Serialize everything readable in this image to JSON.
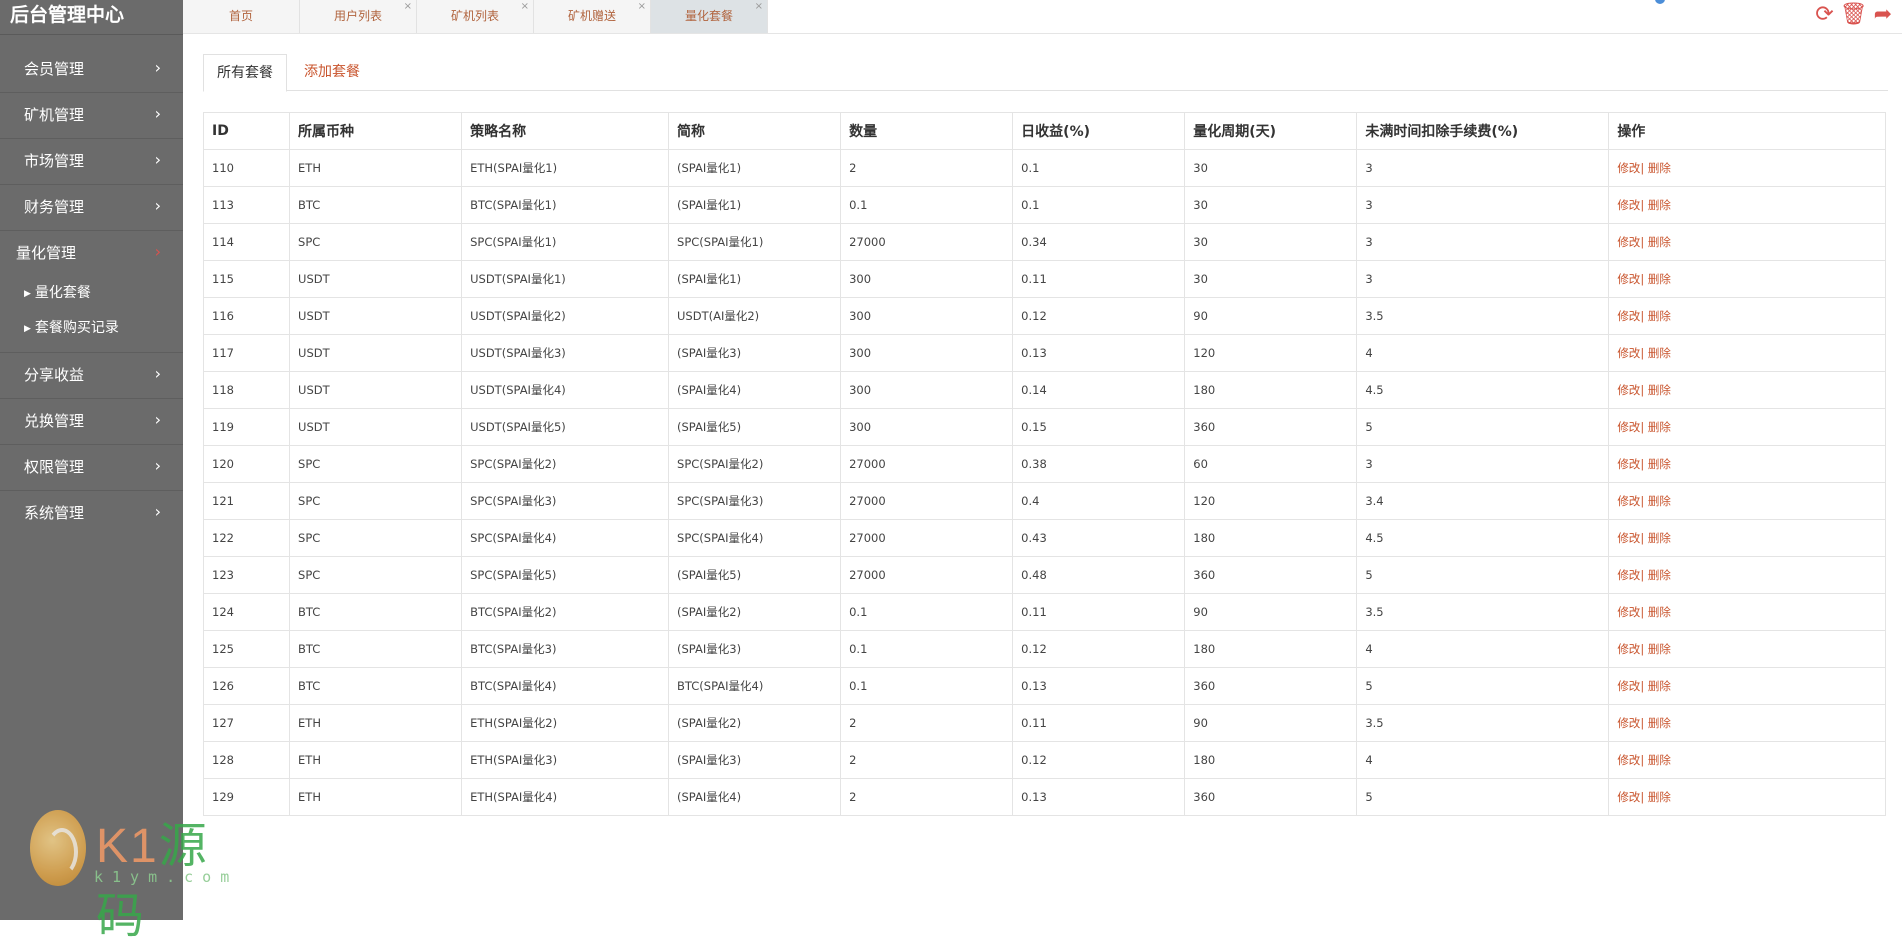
{
  "app_title": "后台管理中心",
  "sidebar": {
    "items": [
      {
        "label": "会员管理",
        "icon": "chevron-right-icon"
      },
      {
        "label": "矿机管理",
        "icon": "chevron-right-icon"
      },
      {
        "label": "市场管理",
        "icon": "chevron-right-icon"
      },
      {
        "label": "财务管理",
        "icon": "chevron-right-icon"
      },
      {
        "label": "量化管理",
        "icon": "chevron-down-icon"
      },
      {
        "label": "分享收益",
        "icon": "chevron-right-icon"
      },
      {
        "label": "兑换管理",
        "icon": "chevron-right-icon"
      },
      {
        "label": "权限管理",
        "icon": "chevron-right-icon"
      },
      {
        "label": "系统管理",
        "icon": "chevron-right-icon"
      }
    ],
    "sub_items": [
      "量化套餐",
      "套餐购买记录"
    ]
  },
  "page_tabs": [
    "首页",
    "用户列表",
    "矿机列表",
    "矿机赠送",
    "量化套餐"
  ],
  "active_page_tab": "量化套餐",
  "top_actions": [
    "refresh-icon",
    "trash-icon",
    "logout-icon"
  ],
  "content_tabs": {
    "all": "所有套餐",
    "add": "添加套餐"
  },
  "table": {
    "headers": [
      "ID",
      "所属币种",
      "策略名称",
      "简称",
      "数量",
      "日收益(%)",
      "量化周期(天)",
      "未满时间扣除手续费(%)",
      "操作"
    ],
    "edit_label": "修改",
    "delete_label": "删除",
    "rows": [
      [
        "110",
        "ETH",
        "ETH(SPAI量化1)",
        "(SPAI量化1)",
        "2",
        "0.1",
        "30",
        "3"
      ],
      [
        "113",
        "BTC",
        "BTC(SPAI量化1)",
        "(SPAI量化1)",
        "0.1",
        "0.1",
        "30",
        "3"
      ],
      [
        "114",
        "SPC",
        "SPC(SPAI量化1)",
        "SPC(SPAI量化1)",
        "27000",
        "0.34",
        "30",
        "3"
      ],
      [
        "115",
        "USDT",
        "USDT(SPAI量化1)",
        "(SPAI量化1)",
        "300",
        "0.11",
        "30",
        "3"
      ],
      [
        "116",
        "USDT",
        "USDT(SPAI量化2)",
        "USDT(AI量化2)",
        "300",
        "0.12",
        "90",
        "3.5"
      ],
      [
        "117",
        "USDT",
        "USDT(SPAI量化3)",
        "(SPAI量化3)",
        "300",
        "0.13",
        "120",
        "4"
      ],
      [
        "118",
        "USDT",
        "USDT(SPAI量化4)",
        "(SPAI量化4)",
        "300",
        "0.14",
        "180",
        "4.5"
      ],
      [
        "119",
        "USDT",
        "USDT(SPAI量化5)",
        "(SPAI量化5)",
        "300",
        "0.15",
        "360",
        "5"
      ],
      [
        "120",
        "SPC",
        "SPC(SPAI量化2)",
        "SPC(SPAI量化2)",
        "27000",
        "0.38",
        "60",
        "3"
      ],
      [
        "121",
        "SPC",
        "SPC(SPAI量化3)",
        "SPC(SPAI量化3)",
        "27000",
        "0.4",
        "120",
        "3.4"
      ],
      [
        "122",
        "SPC",
        "SPC(SPAI量化4)",
        "SPC(SPAI量化4)",
        "27000",
        "0.43",
        "180",
        "4.5"
      ],
      [
        "123",
        "SPC",
        "SPC(SPAI量化5)",
        "(SPAI量化5)",
        "27000",
        "0.48",
        "360",
        "5"
      ],
      [
        "124",
        "BTC",
        "BTC(SPAI量化2)",
        "(SPAI量化2)",
        "0.1",
        "0.11",
        "90",
        "3.5"
      ],
      [
        "125",
        "BTC",
        "BTC(SPAI量化3)",
        "(SPAI量化3)",
        "0.1",
        "0.12",
        "180",
        "4"
      ],
      [
        "126",
        "BTC",
        "BTC(SPAI量化4)",
        "BTC(SPAI量化4)",
        "0.1",
        "0.13",
        "360",
        "5"
      ],
      [
        "127",
        "ETH",
        "ETH(SPAI量化2)",
        "(SPAI量化2)",
        "2",
        "0.11",
        "90",
        "3.5"
      ],
      [
        "128",
        "ETH",
        "ETH(SPAI量化3)",
        "(SPAI量化3)",
        "2",
        "0.12",
        "180",
        "4"
      ],
      [
        "129",
        "ETH",
        "ETH(SPAI量化4)",
        "(SPAI量化4)",
        "2",
        "0.13",
        "360",
        "5"
      ]
    ]
  },
  "watermark": {
    "brand_k1": "K1",
    "brand_yuanma": "源码",
    "url": "k1ym.com"
  },
  "colors": {
    "sidebar_bg": "#6b6b6b",
    "accent": "#c9552e",
    "danger": "#d9534f"
  }
}
